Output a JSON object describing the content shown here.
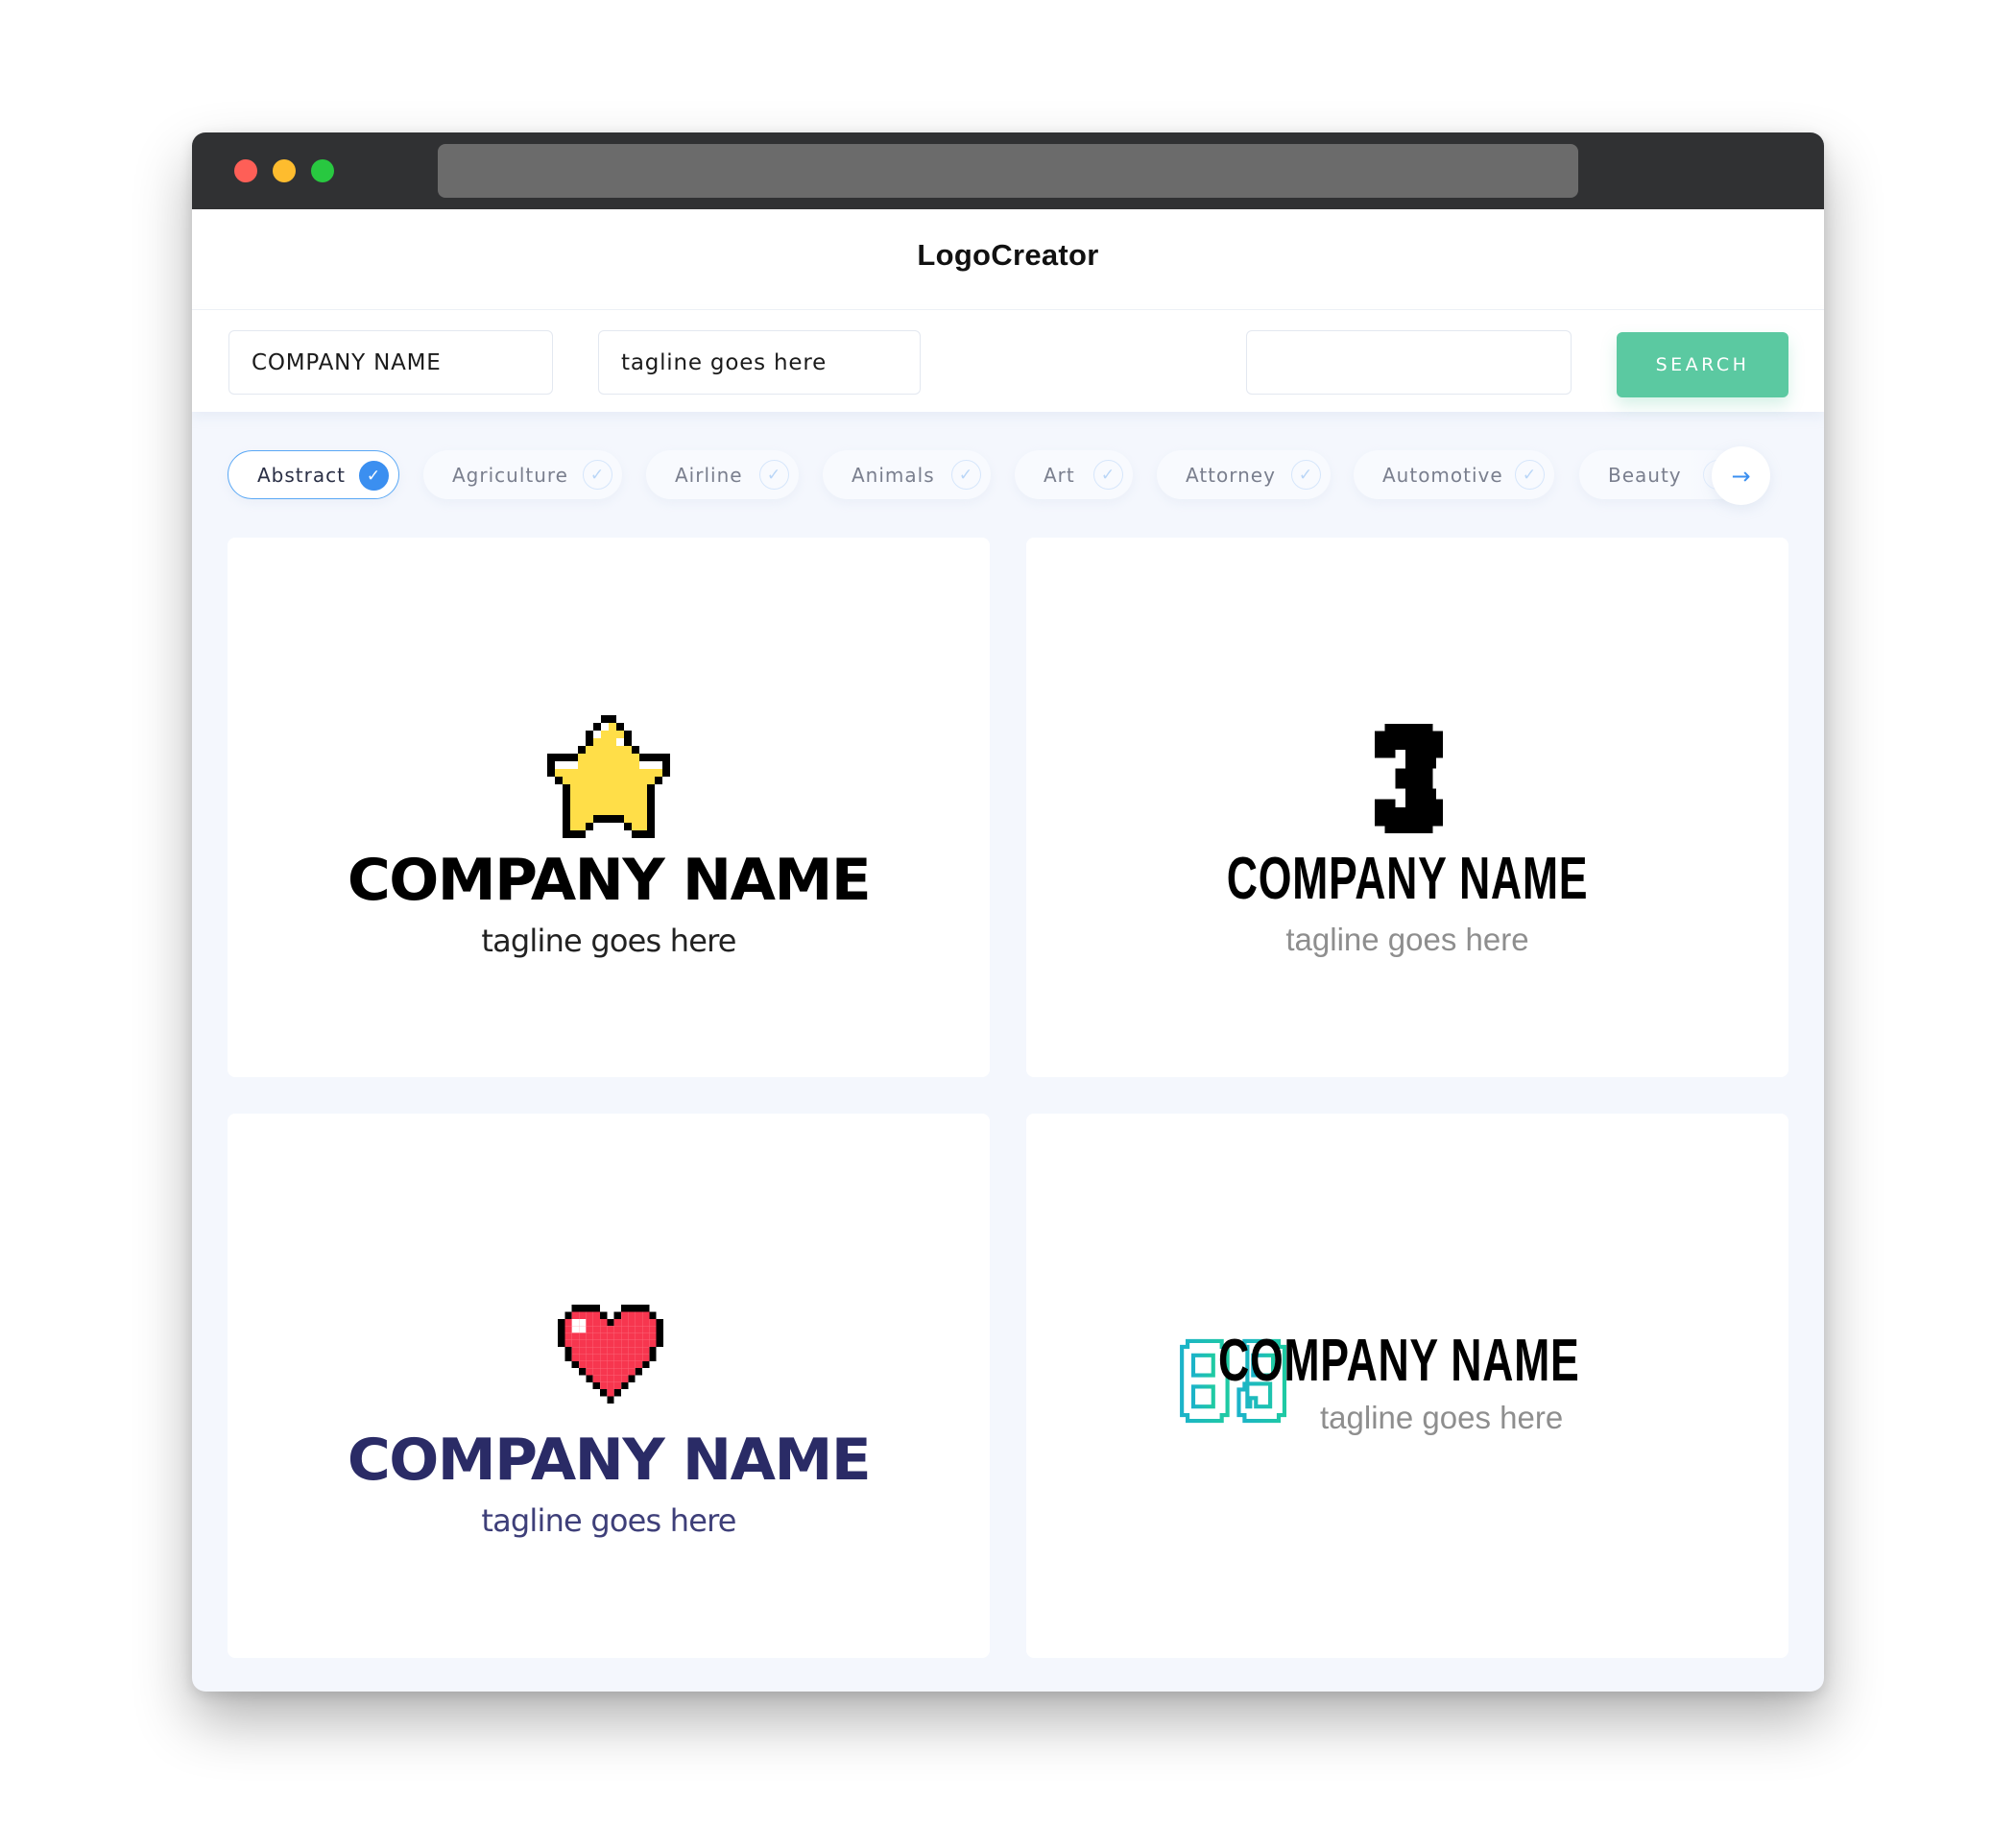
{
  "browser": {
    "window_controls": [
      "close",
      "minimize",
      "maximize"
    ],
    "url": ""
  },
  "header": {
    "title": "LogoCreator"
  },
  "toolbar": {
    "company_name_value": "COMPANY NAME",
    "tagline_value": "tagline goes here",
    "keyword_value": "",
    "search_label": "SEARCH"
  },
  "categories": {
    "items": [
      {
        "label": "Abstract",
        "selected": true
      },
      {
        "label": "Agriculture",
        "selected": false
      },
      {
        "label": "Airline",
        "selected": false
      },
      {
        "label": "Animals",
        "selected": false
      },
      {
        "label": "Art",
        "selected": false
      },
      {
        "label": "Attorney",
        "selected": false
      },
      {
        "label": "Automotive",
        "selected": false
      },
      {
        "label": "Beauty",
        "selected": false
      }
    ],
    "check_icon": "✓",
    "next_icon": "→"
  },
  "logos": [
    {
      "icon": "pixel-star-icon",
      "company_name": "COMPANY NAME",
      "tagline": "tagline goes here",
      "name_color": "#000000",
      "tagline_color": "#222222",
      "icon_color": "#ffde48"
    },
    {
      "icon": "pixel-number-3-icon",
      "company_name": "COMPANY NAME",
      "tagline": "tagline goes here",
      "name_color": "#000000",
      "tagline_color": "#8e8e8e",
      "icon_color": "#000000"
    },
    {
      "icon": "pixel-heart-icon",
      "company_name": "COMPANY NAME",
      "tagline": "tagline goes here",
      "name_color": "#2a2b66",
      "tagline_color": "#3e3f79",
      "icon_color": "#f7364f"
    },
    {
      "icon": "pixel-number-89-icon",
      "company_name": "COMPANY NAME",
      "tagline": "tagline goes here",
      "name_color": "#000000",
      "tagline_color": "#8e8e8e",
      "icon_color": "#1fbfb4"
    }
  ],
  "colors": {
    "accent": "#3b8ff0",
    "search_button": "#5bc9a1",
    "titlebar": "#303133",
    "content_bg": "#f4f7fd"
  }
}
